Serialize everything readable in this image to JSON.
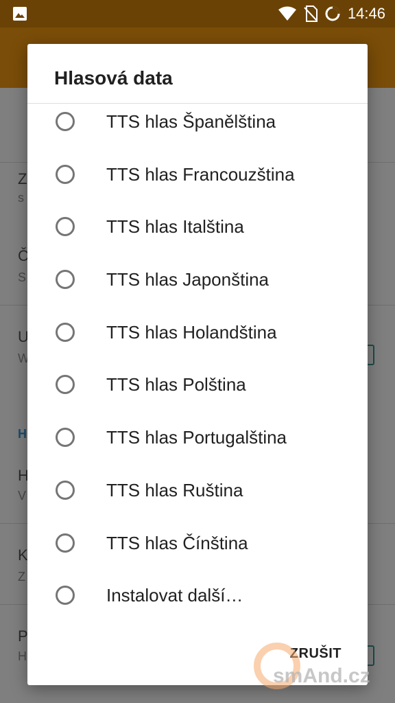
{
  "status_bar": {
    "time": "14:46",
    "icons": [
      "image-icon",
      "wifi-icon",
      "no-sim-icon",
      "loading-circle-icon"
    ]
  },
  "dialog": {
    "title": "Hlasová data",
    "options": [
      {
        "label": "TTS hlas Španělština",
        "selected": false
      },
      {
        "label": "TTS hlas Francouzština",
        "selected": false
      },
      {
        "label": "TTS hlas Italština",
        "selected": false
      },
      {
        "label": "TTS hlas Japonština",
        "selected": false
      },
      {
        "label": "TTS hlas Holandština",
        "selected": false
      },
      {
        "label": "TTS hlas Polština",
        "selected": false
      },
      {
        "label": "TTS hlas Portugalština",
        "selected": false
      },
      {
        "label": "TTS hlas Ruština",
        "selected": false
      },
      {
        "label": "TTS hlas Čínština",
        "selected": false
      },
      {
        "label": "Instalovat další…",
        "selected": false
      }
    ],
    "cancel_label": "ZRUŠIT"
  },
  "background": {
    "items": [
      {
        "title": "Z",
        "subtitle": "s"
      },
      {
        "title": "Č",
        "subtitle": "S"
      },
      {
        "title": "U",
        "subtitle": "W"
      },
      {
        "title": "H",
        "subtitle": ""
      },
      {
        "title": "H",
        "subtitle": "V"
      },
      {
        "title": "K",
        "subtitle": "Z"
      },
      {
        "title": "P",
        "subtitle": "H"
      }
    ]
  },
  "watermark": {
    "text": "smAnd.cz"
  },
  "colors": {
    "status_bar": "#6b4205",
    "toolbar": "#7a4d08",
    "scrim_background": "#7f7f7f",
    "dialog": "#ffffff",
    "radio_border": "#757575"
  }
}
